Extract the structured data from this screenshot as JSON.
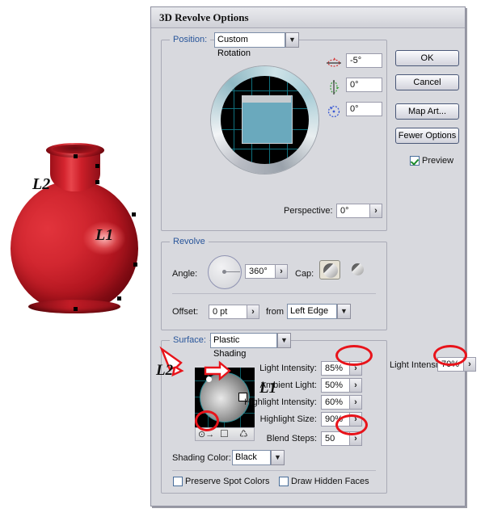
{
  "window": {
    "title": "3D Revolve Options"
  },
  "artwork": {
    "label_l1": "L1",
    "label_l2": "L2",
    "object_color": "#d22730"
  },
  "position": {
    "label": "Position:",
    "value": "Custom Rotation",
    "rotation_x": {
      "icon": "rotate-x-icon",
      "color": "#d43a3a",
      "value": "-5°"
    },
    "rotation_y": {
      "icon": "rotate-y-icon",
      "color": "#3aa03a",
      "value": "0°"
    },
    "rotation_z": {
      "icon": "rotate-z-icon",
      "color": "#3a5ad4",
      "value": "0°"
    },
    "perspective_label": "Perspective:",
    "perspective_value": "0°",
    "stepper_glyph": "›"
  },
  "revolve": {
    "title": "Revolve",
    "angle_label": "Angle:",
    "angle_value": "360°",
    "cap_label": "Cap:",
    "cap_on_icon": "cap-on-icon",
    "cap_off_icon": "cap-off-icon",
    "offset_label": "Offset:",
    "offset_value": "0 pt",
    "from_label": "from",
    "from_value": "Left Edge"
  },
  "surface": {
    "title": "Surface:",
    "shading_value": "Plastic Shading",
    "light_l1_label": "L1",
    "light_l2_label": "L2",
    "toolbar": {
      "new_light_icon": "new-light-icon",
      "move_light_icon": "move-light-behind-icon",
      "delete_light_icon": "trash-icon"
    },
    "fields": [
      {
        "label": "Light Intensity:",
        "value": "85%",
        "highlighted": true
      },
      {
        "label": "Ambient Light:",
        "value": "50%",
        "highlighted": false
      },
      {
        "label": "Highlight Intensity:",
        "value": "60%",
        "highlighted": false
      },
      {
        "label": "Highlight Size:",
        "value": "90%",
        "highlighted": false
      },
      {
        "label": "Blend Steps:",
        "value": "50",
        "highlighted": true
      }
    ],
    "secondary_light": {
      "label": "Light Intensity:",
      "value": "70%",
      "highlighted": true
    },
    "shading_color_label": "Shading Color:",
    "shading_color_value": "Black",
    "preserve_spot_colors_label": "Preserve Spot Colors",
    "preserve_spot_colors_checked": false,
    "draw_hidden_faces_label": "Draw Hidden Faces",
    "draw_hidden_faces_checked": false
  },
  "buttons": {
    "ok": "OK",
    "cancel": "Cancel",
    "map_art": "Map Art...",
    "fewer_options": "Fewer Options",
    "preview_label": "Preview",
    "preview_checked": true
  },
  "annotation_color": "#e8131a"
}
